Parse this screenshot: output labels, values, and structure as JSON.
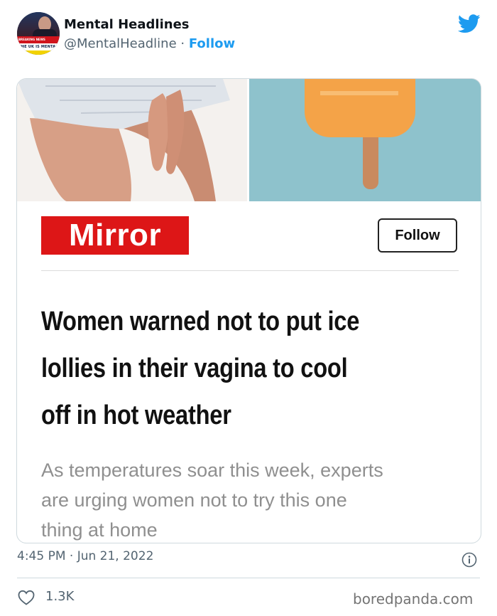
{
  "tweet": {
    "display_name": "Mental Headlines",
    "handle": "@MentalHeadline",
    "separator": "·",
    "follow_label": "Follow",
    "avatar_caption": "THE UK IS MENTAL",
    "avatar_badge": "BREAKING NEWS",
    "timestamp": "4:45 PM · Jun 21, 2022",
    "likes": "1.3K"
  },
  "article_card": {
    "publisher": "Mirror",
    "follow_label": "Follow",
    "headline_lines": [
      "Women warned not to put ice",
      "lollies in their vagina to cool",
      "off in hot weather"
    ],
    "standfirst_lines": [
      "As temperatures soar this week, experts",
      "are urging women not to try this one",
      "thing at home"
    ]
  },
  "watermark": "boredpanda.com",
  "icons": {
    "platform": "twitter-bird-icon",
    "info": "info-icon",
    "like": "heart-icon"
  },
  "colors": {
    "accent": "#1d9bf0",
    "mirror_red": "#dd1617",
    "muted_text": "#536471",
    "popsicle_background": "#8ec2cc",
    "popsicle": "#f4a348"
  }
}
